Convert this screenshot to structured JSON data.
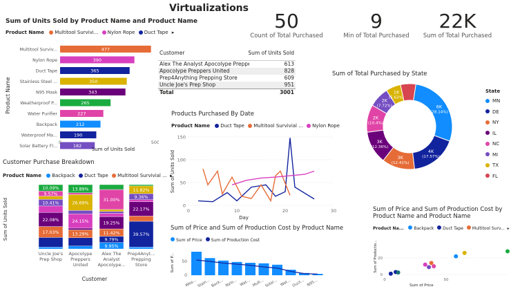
{
  "page_title": "Virtualizations",
  "kpis": [
    {
      "value": "50",
      "caption": "Count of Total Purchased"
    },
    {
      "value": "9",
      "caption": "Min of Total Purchased"
    },
    {
      "value": "22K",
      "caption": "Sum of Total Purchased"
    }
  ],
  "colors": {
    "backpack": "#118DFF",
    "duct_tape": "#12239E",
    "multitool": "#E66C37",
    "nylon_rope": "#D83FBF",
    "n95": "#6B007B",
    "weatherproof": "#E044A7",
    "water_purifier": "#744EC2",
    "stainless": "#D9B300",
    "solar": "#197278",
    "green": "#1AAB40"
  },
  "bar_chart": {
    "title": "Sum of Units Sold by Product Name and Product Name",
    "legend_label": "Product Name",
    "legend_items": [
      {
        "label": "Multitool Survivi...",
        "color": "#E66C37"
      },
      {
        "label": "Nylon Rope",
        "color": "#D83FBF"
      },
      {
        "label": "Duct Tape",
        "color": "#12239E"
      }
    ],
    "ylabel": "Product Name",
    "xlabel": "Sum of Units Sold",
    "tick_labels": [
      "0",
      "500"
    ],
    "chart_data": {
      "type": "bar",
      "categories": [
        "Multitool Surviv...",
        "Nylon Rope",
        "Duct Tape",
        "Stainless Steel ...",
        "N95 Mask",
        "Weatherproof P...",
        "Water Purifier",
        "Backpack",
        "Waterproof Ma...",
        "Solar Battery Fl..."
      ],
      "values": [
        477,
        390,
        365,
        350,
        343,
        265,
        227,
        212,
        190,
        182
      ],
      "colors": [
        "#E66C37",
        "#D83FBF",
        "#12239E",
        "#D9B300",
        "#6B007B",
        "#1AAB40",
        "#E044A7",
        "#118DFF",
        "#12239E",
        "#744EC2"
      ],
      "xlim": [
        0,
        500
      ]
    }
  },
  "table": {
    "col1": "Customer",
    "col2": "Sum of Units Sold",
    "rows": [
      {
        "name": "Alex The Analyst Apocolype Preppers",
        "value": "613"
      },
      {
        "name": "Apocolype Preppers United",
        "value": "828"
      },
      {
        "name": "Prep4Anything Prepping Store",
        "value": "609"
      },
      {
        "name": "Uncle Joe's Prep Shop",
        "value": "951"
      }
    ],
    "total_label": "Total",
    "total_value": "3001"
  },
  "donut": {
    "title": "Sum of Total Purchased by State",
    "legend_title": "State",
    "states": [
      "MN",
      "DE",
      "NY",
      "IL",
      "NC",
      "MI",
      "TX",
      "FL"
    ],
    "state_colors": [
      "#118DFF",
      "#12239E",
      "#E66C37",
      "#6B007B",
      "#E044A7",
      "#744EC2",
      "#D9B300",
      "#D64550"
    ],
    "chart_data": {
      "type": "pie",
      "slices": [
        {
          "label": "6K",
          "pct": "(28.14%)",
          "value": 28.14,
          "color": "#118DFF"
        },
        {
          "label": "4K",
          "pct": "(17.57%)",
          "value": 17.57,
          "color": "#12239E"
        },
        {
          "label": "3K",
          "pct": "(12.41%)",
          "value": 12.41,
          "color": "#E66C37"
        },
        {
          "label": "3K",
          "pct": "(12.36%)",
          "value": 12.36,
          "color": "#6B007B"
        },
        {
          "label": "2K",
          "pct": "(10.4%)",
          "value": 10.4,
          "color": "#E044A7"
        },
        {
          "label": "2K",
          "pct": "(7.72%)",
          "value": 7.72,
          "color": "#744EC2"
        },
        {
          "label": "1K",
          "pct": "(5.63%)",
          "value": 5.63,
          "color": "#D9B300"
        },
        {
          "label": "",
          "pct": "",
          "value": 5.77,
          "color": "#D64550"
        }
      ]
    }
  },
  "line_chart": {
    "title": "Products Purchased By Date",
    "legend_label": "Product Name",
    "legend_items": [
      {
        "label": "Duct Tape",
        "color": "#12239E"
      },
      {
        "label": "Multitool Survivial ...",
        "color": "#E66C37"
      },
      {
        "label": "Nylon Rope",
        "color": "#D83FBF"
      }
    ],
    "ylabel": "Sum of Units Sold",
    "xlabel": "Day",
    "y_ticks": [
      "0",
      "50",
      "100",
      "150"
    ],
    "x_ticks": [
      "0",
      "10",
      "20",
      "30"
    ],
    "chart_data": {
      "type": "line",
      "xlim": [
        0,
        30
      ],
      "ylim": [
        0,
        150
      ],
      "series": [
        {
          "name": "Duct Tape",
          "color": "#12239E",
          "x": [
            2,
            5,
            8,
            10,
            13,
            16,
            18,
            20,
            21,
            22,
            26
          ],
          "y": [
            10,
            8,
            28,
            10,
            40,
            45,
            20,
            30,
            148,
            40,
            14
          ]
        },
        {
          "name": "Multitool Survivial ...",
          "color": "#E66C37",
          "x": [
            3,
            4,
            6,
            7,
            9,
            11,
            13,
            15,
            17,
            18,
            19,
            21
          ],
          "y": [
            80,
            45,
            75,
            25,
            62,
            20,
            15,
            45,
            10,
            65,
            75,
            22
          ]
        },
        {
          "name": "Nylon Rope",
          "color": "#D83FBF",
          "x": [
            9,
            12,
            15,
            18,
            21,
            24,
            26
          ],
          "y": [
            45,
            55,
            60,
            62,
            65,
            68,
            75
          ]
        }
      ]
    }
  },
  "stacked": {
    "title": "Customer Purchase Breakdown",
    "legend_label": "Product Name",
    "legend_items": [
      {
        "label": "Backpack",
        "color": "#118DFF"
      },
      {
        "label": "Duct Tape",
        "color": "#12239E"
      },
      {
        "label": "Multitool Survivial ...",
        "color": "#E66C37"
      }
    ],
    "ylabel": "Sum of Units Sold",
    "xlabel": "Customer",
    "chart_data": {
      "type": "bar",
      "categories": [
        "Uncle Joe's|Prep Shop",
        "Apocolype|Preppers|United",
        "Alex The|Analyst|Apocolype...",
        "Prep4Anyt...|Prepping|Store"
      ],
      "series": [
        {
          "name": "Backpack",
          "color": "#118DFF",
          "values": [
            3,
            5,
            9.95,
            3
          ]
        },
        {
          "name": "Duct Tape",
          "color": "#12239E",
          "values": [
            15,
            14,
            9.79,
            39.57
          ]
        },
        {
          "name": "Multitool Survivial ...",
          "color": "#E66C37",
          "values": [
            17.03,
            13.29,
            11.42,
            8
          ]
        },
        {
          "name": "N95 Mask",
          "color": "#6B007B",
          "values": [
            22.08,
            3,
            19.25,
            22.17
          ]
        },
        {
          "name": "Nylon Rope",
          "color": "#D83FBF",
          "values": [
            10,
            24.15,
            5,
            3
          ]
        },
        {
          "name": "Water Purifier",
          "color": "#744EC2",
          "values": [
            10.41,
            6,
            3,
            9.36
          ]
        },
        {
          "name": "Stainless Steel",
          "color": "#D9B300",
          "values": [
            5,
            26.69,
            3,
            11.82
          ]
        },
        {
          "name": "Weatherproof",
          "color": "#E044A7",
          "values": [
            7.86,
            3,
            31.0,
            0
          ]
        },
        {
          "name": "Green",
          "color": "#1AAB40",
          "values": [
            10.09,
            13.89,
            7.59,
            2
          ]
        }
      ],
      "labels": [
        [
          null,
          null,
          "17.03%",
          "22.08%",
          null,
          "10.41%",
          null,
          "9.57%",
          "10.09%"
        ],
        [
          null,
          null,
          "13.29%",
          null,
          "24.15%",
          null,
          "26.69%",
          null,
          "13.89%"
        ],
        [
          "9.95%",
          "9.79%",
          "11.42%",
          "19.25%",
          null,
          null,
          null,
          "31.00%",
          null
        ],
        [
          null,
          "39.57%",
          null,
          "22.17%",
          null,
          "9.36%",
          "11.82%",
          null,
          null
        ]
      ]
    }
  },
  "combo": {
    "title": "Sum of Price and Sum of Production Cost by Product Name",
    "legend_items": [
      {
        "label": "Sum of Price",
        "color": "#118DFF"
      },
      {
        "label": "Sum of Production Cost",
        "color": "#12239E"
      }
    ],
    "ylabel": "Sum of P...",
    "y_ticks": [
      "0",
      "50"
    ],
    "chart_data": {
      "type": "bar",
      "categories": [
        "Wea...",
        "Stain...",
        "Back...",
        "Nylo...",
        "Wat...",
        "Mult...",
        "Solar...",
        "Wat...",
        "Duct...",
        "N95..."
      ],
      "bar_values": [
        85,
        62,
        53,
        48,
        45,
        43,
        38,
        20,
        8,
        5
      ],
      "line_values": [
        55,
        50,
        44,
        40,
        36,
        30,
        26,
        14,
        6,
        4
      ],
      "ylim": [
        0,
        100
      ]
    }
  },
  "scatter": {
    "title_line1": "Sum of Price and Sum of Production Cost by",
    "title_line2": "Product Name and Product Name",
    "legend_label": "Product Na...",
    "legend_items": [
      {
        "label": "Backpack",
        "color": "#118DFF"
      },
      {
        "label": "Duct Tape",
        "color": "#12239E"
      },
      {
        "label": "Multitool Surv...",
        "color": "#E66C37"
      }
    ],
    "ylabel": "Sum of Productio...",
    "xlabel": "Sum of Price",
    "x_ticks": [
      "0",
      "50"
    ],
    "y_ticks": [
      "0",
      "20"
    ],
    "chart_data": {
      "type": "scatter",
      "xlim": [
        0,
        100
      ],
      "ylim": [
        0,
        45
      ],
      "points": [
        {
          "x": 5,
          "y": 1,
          "color": "#12239E"
        },
        {
          "x": 9,
          "y": 3,
          "color": "#12239E"
        },
        {
          "x": 11,
          "y": 2.5,
          "color": "#197278"
        },
        {
          "x": 33,
          "y": 12,
          "color": "#D83FBF"
        },
        {
          "x": 36,
          "y": 9,
          "color": "#744EC2"
        },
        {
          "x": 38,
          "y": 14,
          "color": "#E66C37"
        },
        {
          "x": 40,
          "y": 10,
          "color": "#E044A7"
        },
        {
          "x": 58,
          "y": 22,
          "color": "#118DFF"
        },
        {
          "x": 65,
          "y": 26,
          "color": "#D9B300"
        },
        {
          "x": 100,
          "y": 28,
          "color": "#1AAB40"
        }
      ]
    }
  }
}
